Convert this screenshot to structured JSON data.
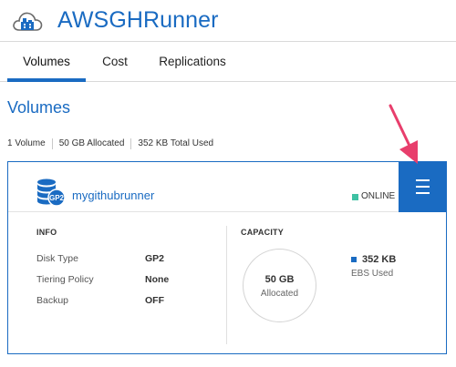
{
  "app": {
    "title": "AWSGHRunner"
  },
  "tabs": [
    {
      "label": "Volumes"
    },
    {
      "label": "Cost"
    },
    {
      "label": "Replications"
    }
  ],
  "section": {
    "title": "Volumes"
  },
  "summary": [
    {
      "text": "1 Volume"
    },
    {
      "text": "50 GB Allocated"
    },
    {
      "text": "352 KB Total Used"
    }
  ],
  "volume": {
    "icon_label": "GP2",
    "name": "mygithubrunner",
    "status": "ONLINE",
    "status_color": "#3ec1a3",
    "info": {
      "heading": "INFO",
      "rows": [
        {
          "key": "Disk Type",
          "value": "GP2"
        },
        {
          "key": "Tiering Policy",
          "value": "None"
        },
        {
          "key": "Backup",
          "value": "OFF"
        }
      ]
    },
    "capacity": {
      "heading": "CAPACITY",
      "allocated_value": "50 GB",
      "allocated_label": "Allocated",
      "used_value": "352 KB",
      "used_label": "EBS Used"
    }
  },
  "colors": {
    "accent": "#1a6bc2",
    "arrow": "#e83e6c",
    "online": "#3ec1a3"
  },
  "icons": {
    "logo": "cloud-building-icon",
    "volume": "database-icon",
    "menu": "hamburger-menu-icon",
    "pointer": "arrow-pointer-icon"
  }
}
